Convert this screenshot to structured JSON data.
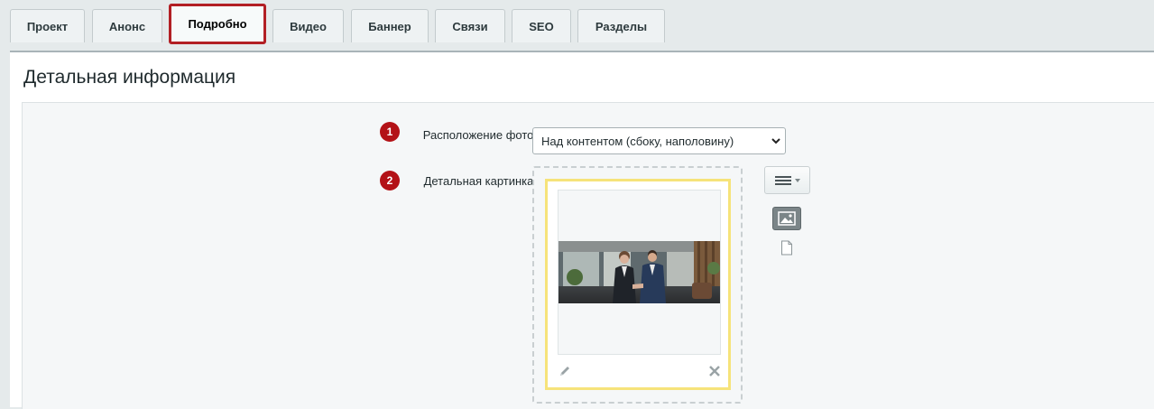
{
  "tabs": [
    {
      "label": "Проект"
    },
    {
      "label": "Анонс"
    },
    {
      "label": "Подробно",
      "active": true
    },
    {
      "label": "Видео"
    },
    {
      "label": "Баннер"
    },
    {
      "label": "Связи"
    },
    {
      "label": "SEO"
    },
    {
      "label": "Разделы"
    }
  ],
  "panel": {
    "title": "Детальная информация"
  },
  "form": {
    "photo_position": {
      "badge": "1",
      "label": "Расположение фото:",
      "value": "Над контентом (сбоку, наполовину)"
    },
    "detail_image": {
      "badge": "2",
      "label": "Детальная картинка:"
    }
  },
  "colors": {
    "active_tab_border": "#b21f24",
    "badge": "#b31217",
    "image_card_border": "#f6e37a"
  }
}
